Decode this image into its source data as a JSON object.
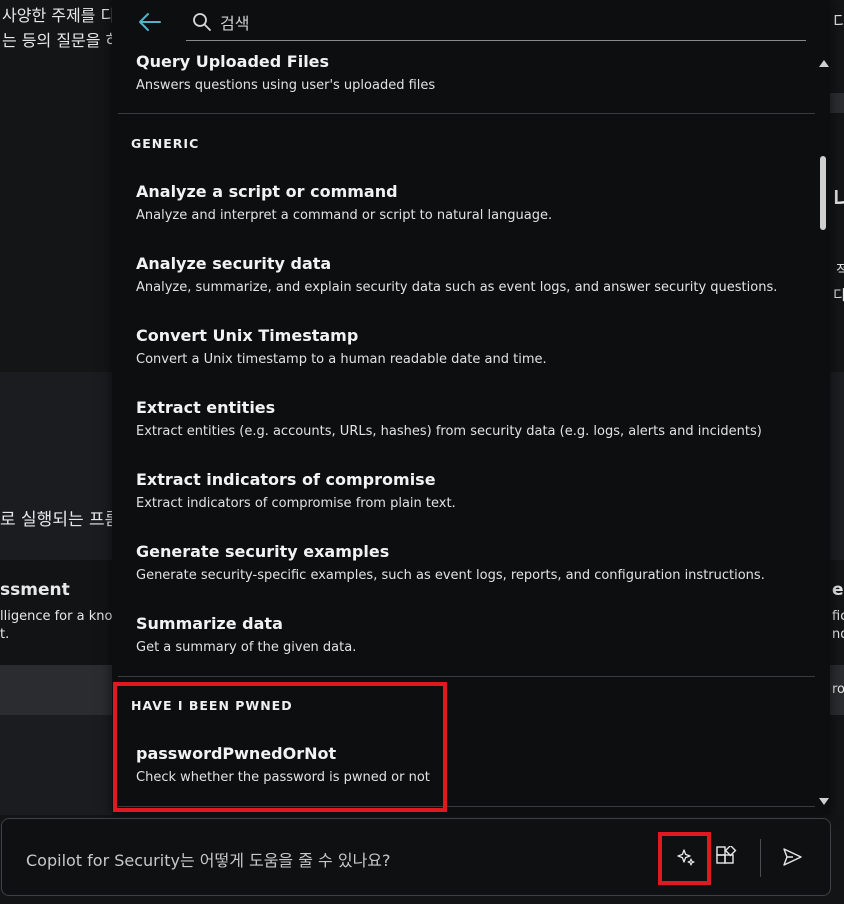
{
  "background": {
    "left_line1": "사양한 주제를 디",
    "left_line2": "는 등의 질문을 하",
    "left_mid_text": "로 실행되는 프롬",
    "left_card_title": "ssment",
    "left_card_desc1": "lligence for a know",
    "left_card_desc2": "t.",
    "right_text1": "디",
    "right_text2": "니",
    "right_text3": "적",
    "right_text4": "디",
    "right_card_title": "en",
    "right_card_desc1": "fic",
    "right_card_desc2": "nd",
    "right_strip_text": "ro"
  },
  "search": {
    "placeholder": "검색"
  },
  "sections": [
    {
      "header": "",
      "items": [
        {
          "title": "Query Uploaded Files",
          "desc": "Answers questions using user's uploaded files"
        }
      ]
    },
    {
      "header": "GENERIC",
      "items": [
        {
          "title": "Analyze a script or command",
          "desc": "Analyze and interpret a command or script to natural language."
        },
        {
          "title": "Analyze security data",
          "desc": "Analyze, summarize, and explain security data such as event logs, and answer security questions."
        },
        {
          "title": "Convert Unix Timestamp",
          "desc": "Convert a Unix timestamp to a human readable date and time."
        },
        {
          "title": "Extract entities",
          "desc": "Extract entities (e.g. accounts, URLs, hashes) from security data (e.g. logs, alerts and incidents)"
        },
        {
          "title": "Extract indicators of compromise",
          "desc": "Extract indicators of compromise from plain text."
        },
        {
          "title": "Generate security examples",
          "desc": "Generate security-specific examples, such as event logs, reports, and configuration instructions."
        },
        {
          "title": "Summarize data",
          "desc": "Get a summary of the given data."
        }
      ]
    },
    {
      "header": "HAVE I BEEN PWNED",
      "items": [
        {
          "title": "passwordPwnedOrNot",
          "desc": "Check whether the password is pwned or not"
        }
      ]
    }
  ],
  "prompt": {
    "placeholder": "Copilot for Security는 어떻게 도움을 줄 수 있나요?"
  },
  "colors": {
    "accent": "#4fb3c8",
    "highlight": "#e0191e",
    "panel_bg": "#0d0e10"
  },
  "icons": {
    "back": "arrow-left-icon",
    "search": "search-icon",
    "prompts": "sparkle-icon",
    "plugins": "plugins-grid-icon",
    "send": "send-icon"
  }
}
